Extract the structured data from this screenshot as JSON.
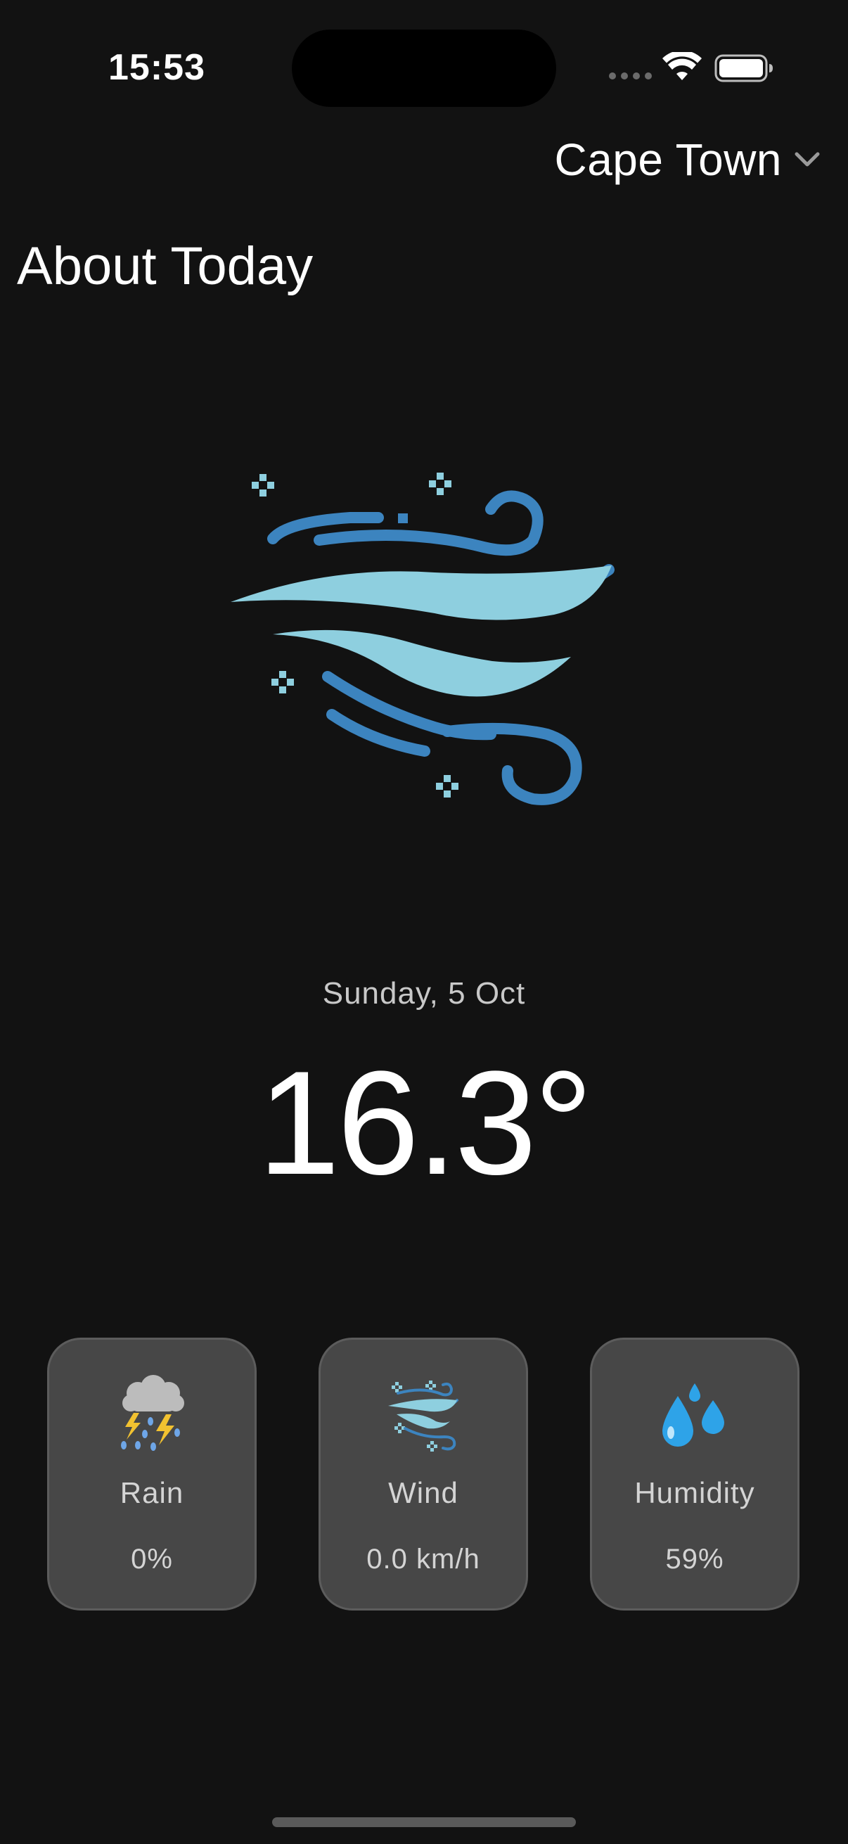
{
  "status_bar": {
    "time": "15:53"
  },
  "header": {
    "location": "Cape Town",
    "location_icon": "chevron-down-icon"
  },
  "page_title": "About Today",
  "hero": {
    "icon": "wind-icon"
  },
  "date": "Sunday, 5 Oct",
  "temperature": "16.3°",
  "cards": [
    {
      "icon": "thunderstorm-rain-icon",
      "label": "Rain",
      "value": "0%"
    },
    {
      "icon": "wind-icon",
      "label": "Wind",
      "value": "0.0 km/h"
    },
    {
      "icon": "water-drops-icon",
      "label": "Humidity",
      "value": "59%"
    }
  ],
  "colors": {
    "background": "#121212",
    "card": "#474747",
    "wind_light": "#8ecfdf",
    "wind_dark": "#3c84bf",
    "humidity_blue": "#2ea3e8"
  }
}
